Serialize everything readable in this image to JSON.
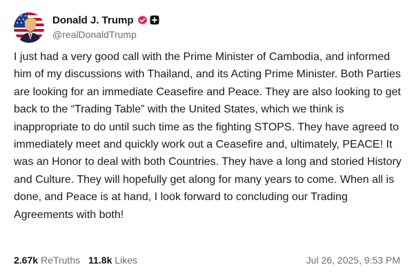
{
  "author": {
    "display_name": "Donald J. Trump",
    "handle": "@realDonaldTrump",
    "avatar_icon": "avatar-photo",
    "verified_icon": "verified-badge-icon",
    "plus_icon": "plus-badge-icon"
  },
  "post": {
    "text": "I just had a very good call with the Prime Minister of Cambodia, and informed him of my discussions with Thailand, and its Acting Prime Minister. Both Parties are looking for an immediate Ceasefire and Peace. They are also looking to get back to the “Trading Table” with the United States, which we think is inappropriate to do until such time as the fighting STOPS. They have agreed to immediately meet and quickly work out a Ceasefire and, ultimately, PEACE! It was an Honor to deal with both Countries. They have a long and storied History and Culture. They will hopefully get along for many years to come. When all is done, and Peace is at hand, I look forward to concluding our Trading Agreements with both!"
  },
  "stats": {
    "retruths_count": "2.67k",
    "retruths_label": "ReTruths",
    "likes_count": "11.8k",
    "likes_label": "Likes"
  },
  "timestamp": "Jul 26, 2025, 9:53 PM",
  "colors": {
    "verified": "#e0245e",
    "secondary_text": "#6b6f76",
    "primary_text": "#0f1419"
  }
}
